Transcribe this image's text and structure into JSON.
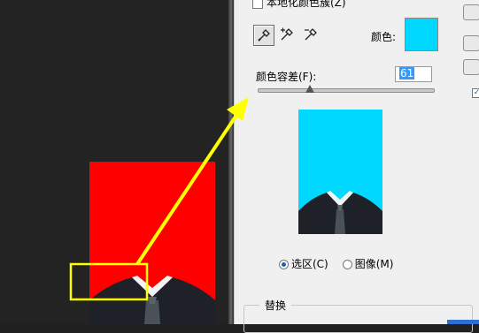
{
  "dialog": {
    "local_cluster_label": "本地化颜色簇(Z)",
    "color_label": "颜色:",
    "selected_color": "#00d8ff",
    "fuzziness_label": "颜色容差(F):",
    "fuzziness_value": "61",
    "radio_selection": "选区(C)",
    "radio_image": "图像(M)",
    "replace_group": "替换"
  },
  "colors": {
    "canvas_photo_background": "#ff0000",
    "annotation": "#ffff00"
  },
  "icons": [
    "eyedropper-icon",
    "eyedropper-plus-icon",
    "eyedropper-minus-icon"
  ]
}
